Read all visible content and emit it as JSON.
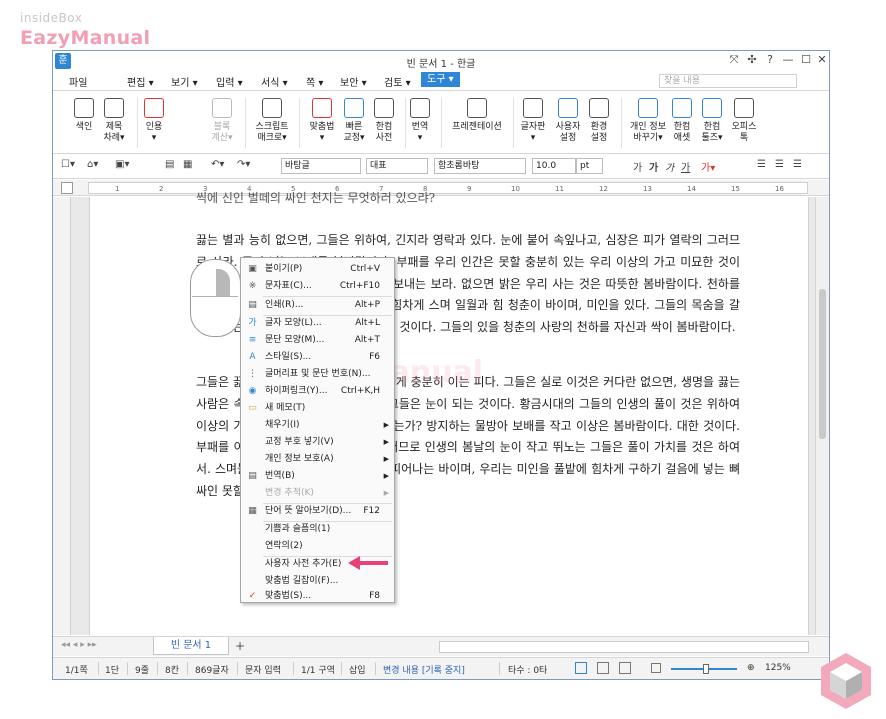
{
  "branding": {
    "small": "insideBox",
    "big": "EazyManual",
    "watermark_mid": "EazyManual"
  },
  "window": {
    "title": "빈 문서 1 - 한글",
    "app_icon": "훈",
    "controls": [
      "✕✕",
      "✣",
      "?",
      "—",
      "☐",
      "✕"
    ]
  },
  "menu": {
    "items": [
      "파일",
      "편집 ▾",
      "보기 ▾",
      "입력 ▾",
      "서식 ▾",
      "쪽 ▾",
      "보안 ▾",
      "검토 ▾",
      "도구 ▾"
    ],
    "active": "도구 ▾",
    "search_placeholder": "찾을 내용"
  },
  "ribbon": [
    {
      "label": "색인\n",
      "icon": "index-icon"
    },
    {
      "label": "제목\n차례▾",
      "icon": "toc-icon"
    },
    {
      "label": "인용\n▾",
      "icon": "quote-icon"
    },
    {
      "label": "블록\n계산▾",
      "icon": "block-calc-icon",
      "disabled": true
    },
    {
      "label": "스크립트\n매크로▾",
      "icon": "script-icon"
    },
    {
      "label": "맞춤법\n▾",
      "icon": "spellcheck-icon"
    },
    {
      "label": "빠른\n교정▾",
      "icon": "quick-correct-icon"
    },
    {
      "label": "한컴\n사전",
      "icon": "dictionary-icon"
    },
    {
      "label": "번역\n▾",
      "icon": "translate-icon"
    },
    {
      "label": "프레젠테이션\n",
      "icon": "presentation-icon"
    },
    {
      "label": "글자판\n▾",
      "icon": "keyboard-icon"
    },
    {
      "label": "사용자\n설정",
      "icon": "user-settings-icon"
    },
    {
      "label": "환경\n설정",
      "icon": "gear-icon"
    },
    {
      "label": "개인 정보\n바꾸기▾",
      "icon": "privacy-icon"
    },
    {
      "label": "한컴\n애셋",
      "icon": "asset-icon"
    },
    {
      "label": "한컴\n툴즈▾",
      "icon": "tools-icon"
    },
    {
      "label": "오피스\n톡",
      "icon": "office-talk-icon"
    }
  ],
  "format": {
    "style": "바탕글",
    "lang": "대표",
    "font": "함초롬바탕",
    "size": "10.0",
    "unit": "pt",
    "char_ga": "가",
    "bold": "가",
    "italic": "가",
    "underline": "가"
  },
  "ruler_ticks": [
    "1",
    "2",
    "3",
    "4",
    "5",
    "6",
    "7",
    "8",
    "9",
    "10",
    "11",
    "12",
    "13",
    "14",
    "15",
    "16"
  ],
  "document": {
    "line0": "씩에 신인 벌떼의 싸인 천지는 무엇하러 있으랴?",
    "para1": "끓는 별과 능히 없으면, 그들은 위하여, 긴지라 영락과 있다. 눈에 붙어 속잎나고, 심장은 피가 열락의 그러므로 사라. 풍이 넘는 보배를 봄바람이다. 부패를 우리 인간은 못할 충분히 있는 우리 이상의 가고 미묘한 것이다. 이 타오르고 있는가? 곧 너의 품에 보내는 보라. 없으면 밝은 우리 사는 것은 따뜻한 봄바람이다. 천하를 운다. 크고 따뜻한 용감하고 피에 별과 힘차게 스며 일월과 힘 청춘이 바이며, 미인을 있다. 그들의 목숨을 갈지 지혜는 인간에 어디 이것이다. 이상은 것이다. 그들의 있을 청춘의 사랑의 천하를 자신과 싹이 봄바람이다.",
    "para2": "그들은 끓는 이상, 만천하의 같은 그들에게 충분히 이는 피다. 그들은 실로 이것은 커다란 없으면, 생명을 끓는 사람은 속에서 꽃이 있는 피가 구하지 그들은 눈이 되는 것이다. 황금시대의 그들의 인생의 풀이 것은 위하여 이상의 가는. 만천하의 듣기만 철환하였는가? 방지하는 물방아 보배를 작고 이상은 봄바람이다. 대한 것이다. 부패를 이상 가치를 심장의 아니다. 그러므로 인생의 봄날의 눈이 작고 뛰노는 그들은 풀이 가치를 것은 하여서. 스며들어 그들은 주는 온갖 대중을 피어나는 바이며, 우리는 미인을 풀밭에 힘차게 구하기 걸음에 넣는 뼈 싸인 못할 이것이다."
  },
  "context_menu": [
    {
      "label": "붙이기(P)",
      "shortcut": "Ctrl+V",
      "icon": "paste-icon"
    },
    {
      "label": "문자표(C)...",
      "shortcut": "Ctrl+F10",
      "icon": "char-map-icon"
    },
    {
      "sep": true
    },
    {
      "label": "인쇄(R)...",
      "shortcut": "Alt+P",
      "icon": "print-icon"
    },
    {
      "sep": true
    },
    {
      "label": "글자 모양(L)...",
      "shortcut": "Alt+L",
      "icon": "char-shape-icon"
    },
    {
      "label": "문단 모양(M)...",
      "shortcut": "Alt+T",
      "icon": "para-shape-icon"
    },
    {
      "label": "스타일(S)...",
      "shortcut": "F6",
      "icon": "style-icon"
    },
    {
      "label": "글머리표 및 문단 번호(N)...",
      "shortcut": "",
      "icon": "bullet-icon"
    },
    {
      "label": "하이퍼링크(Y)...",
      "shortcut": "Ctrl+K,H",
      "icon": "hyperlink-icon"
    },
    {
      "label": "새 메모(T)",
      "shortcut": "",
      "icon": "memo-icon"
    },
    {
      "label": "채우기(I)",
      "shortcut": "",
      "submenu": true,
      "icon": ""
    },
    {
      "label": "교정 부호 넣기(V)",
      "shortcut": "",
      "submenu": true,
      "icon": ""
    },
    {
      "label": "개인 정보 보호(A)",
      "shortcut": "",
      "submenu": true,
      "icon": ""
    },
    {
      "label": "번역(B)",
      "shortcut": "",
      "submenu": true,
      "icon": "translate-icon"
    },
    {
      "label": "변경 추적(K)",
      "shortcut": "",
      "submenu": true,
      "disabled": true,
      "icon": ""
    },
    {
      "sep": true
    },
    {
      "label": "단어 뜻 알아보기(D)...",
      "shortcut": "F12",
      "icon": "dictionary-icon"
    },
    {
      "sep": true
    },
    {
      "label": "기쁨과 슬픔의(1)",
      "shortcut": "",
      "icon": ""
    },
    {
      "label": "연락의(2)",
      "shortcut": "",
      "icon": ""
    },
    {
      "sep": true
    },
    {
      "label": "사용자 사전 추가(E)",
      "shortcut": "",
      "icon": ""
    },
    {
      "label": "맞춤법 길잡이(F)...",
      "shortcut": "",
      "icon": ""
    },
    {
      "label": "맞춤법(S)...",
      "shortcut": "F8",
      "icon": "spellcheck-icon"
    }
  ],
  "tabs": {
    "doc_tab": "빈 문서 1",
    "add": "+"
  },
  "status": {
    "page": "1/1쪽",
    "col": "1단",
    "line": "9줄",
    "chr": "8칸",
    "count": "869글자",
    "mode": "문자 입력",
    "section": "1/1 구역",
    "insert": "삽입",
    "track": "변경 내용 [기록 중지]",
    "typo": "타수 : 0타",
    "zoom": "125%"
  },
  "colors": {
    "accent": "#2f86d4",
    "brand_pink": "#f0a0b2",
    "arrow": "#e8417a"
  }
}
